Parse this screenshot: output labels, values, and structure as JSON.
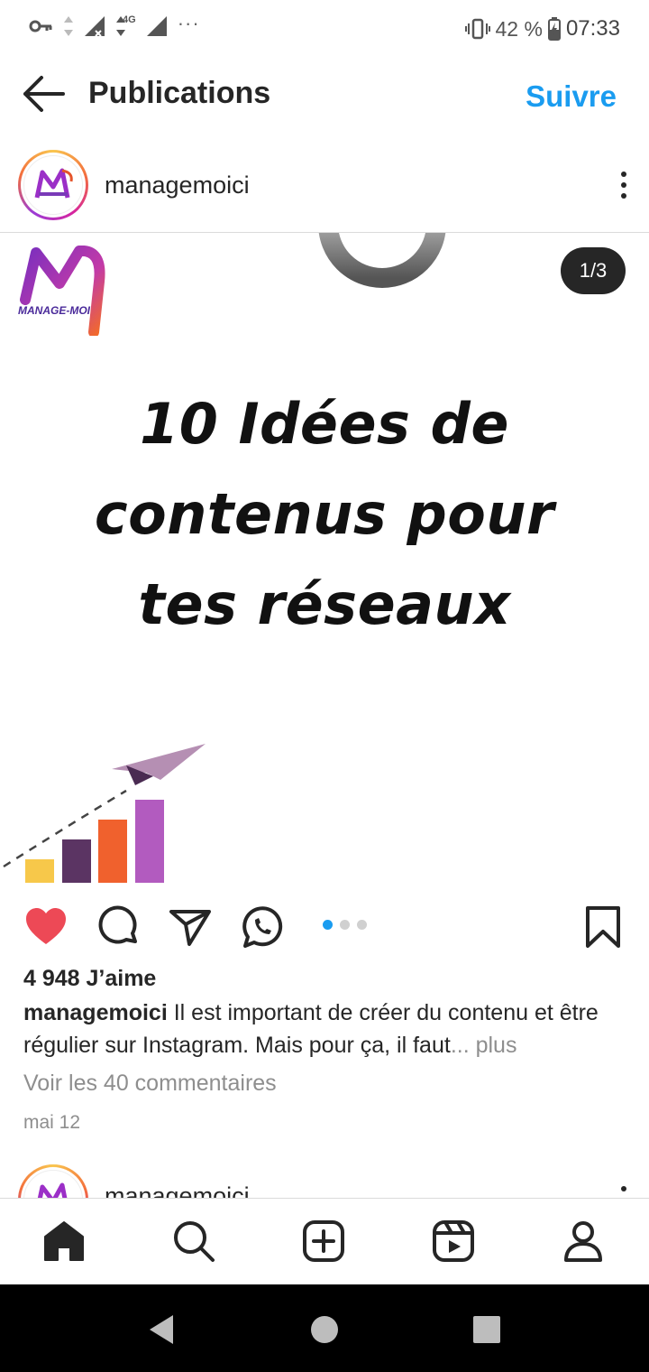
{
  "status_bar": {
    "network": "4G",
    "more": "···",
    "battery": "42 %",
    "time": "07:33"
  },
  "header": {
    "title": "Publications",
    "follow_label": "Suivre"
  },
  "post": {
    "username": "managemoici",
    "image": {
      "counter": "1/3",
      "logo_text": "MANAGE-MOI",
      "title_lines": [
        "10 Idées de",
        "contenus pour",
        "tes réseaux"
      ]
    },
    "carousel": {
      "total": 3,
      "active_index": 0
    },
    "likes": "4 948 J’aime",
    "caption_user": "managemoici",
    "caption_text": " Il est important de créer du contenu et être régulier sur Instagram. Mais pour ça, il faut",
    "caption_more": "... plus",
    "comments_link": "Voir les 40 commentaires",
    "date": "mai 12",
    "liked": true
  },
  "next_post": {
    "username": "managemoici"
  },
  "bottom_nav": {
    "items": [
      "home-icon",
      "search-icon",
      "create-icon",
      "reels-icon",
      "profile-icon"
    ]
  },
  "colors": {
    "accent": "#1a9cf0",
    "like": "#ed4956"
  }
}
